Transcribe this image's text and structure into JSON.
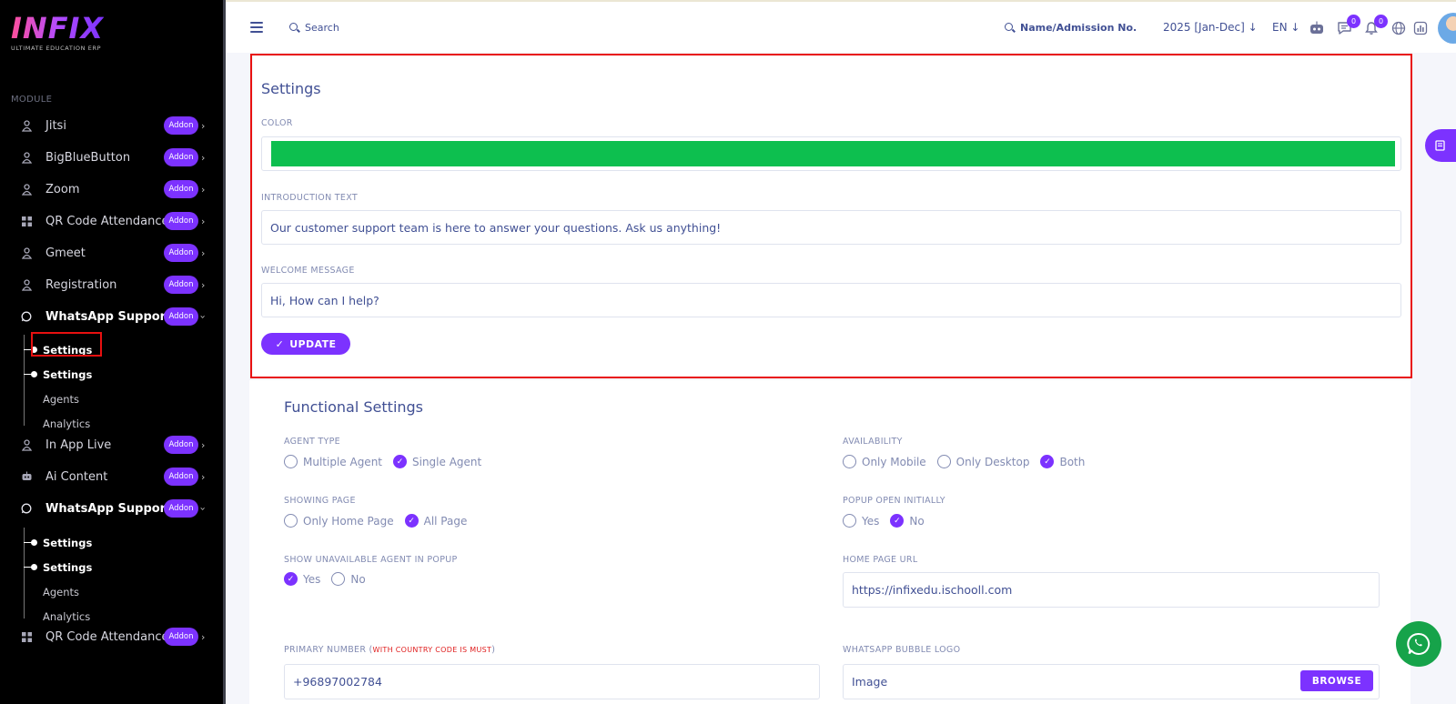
{
  "brand": {
    "name": "INFIX",
    "tagline": "ULTIMATE EDUCATION ERP"
  },
  "sidebar": {
    "section_label": "MODULE",
    "badge_label": "Addon",
    "items": [
      {
        "label": "Jitsi",
        "icon": "user-icon"
      },
      {
        "label": "BigBlueButton",
        "icon": "user-icon"
      },
      {
        "label": "Zoom",
        "icon": "user-icon"
      },
      {
        "label": "QR Code Attendance",
        "icon": "grid-icon"
      },
      {
        "label": "Gmeet",
        "icon": "user-icon"
      },
      {
        "label": "Registration",
        "icon": "user-icon"
      },
      {
        "label": "WhatsApp Support",
        "icon": "whatsapp-icon"
      },
      {
        "label": "In App Live",
        "icon": "user-icon"
      },
      {
        "label": "Ai Content",
        "icon": "robot-icon"
      },
      {
        "label": "WhatsApp Support",
        "icon": "whatsapp-icon"
      },
      {
        "label": "QR Code Attendance",
        "icon": "grid-icon"
      }
    ],
    "sub_group_1": [
      "Settings",
      "Settings",
      "Agents",
      "Analytics"
    ],
    "sub_group_2": [
      "Settings",
      "Settings",
      "Agents",
      "Analytics"
    ]
  },
  "topbar": {
    "search_label": "Search",
    "student_search_label": "Name/Admission No.",
    "session": "2025 [Jan-Dec]",
    "language": "EN",
    "message_count": "0",
    "notification_count": "0"
  },
  "settings_panel": {
    "title": "Settings",
    "color_label": "COLOR",
    "color_value": "#0dbf4f",
    "intro_label": "INTRODUCTION TEXT",
    "intro_value": "Our customer support team is here to answer your questions. Ask us anything!",
    "welcome_label": "WELCOME MESSAGE",
    "welcome_value": "Hi, How can I help?",
    "update_label": "UPDATE"
  },
  "functional": {
    "title": "Functional Settings",
    "agent_type": {
      "label": "AGENT TYPE",
      "options": [
        "Multiple Agent",
        "Single Agent"
      ],
      "selected": "Single Agent"
    },
    "availability": {
      "label": "AVAILABILITY",
      "options": [
        "Only Mobile",
        "Only Desktop",
        "Both"
      ],
      "selected": "Both"
    },
    "showing_page": {
      "label": "SHOWING PAGE",
      "options": [
        "Only Home Page",
        "All Page"
      ],
      "selected": "All Page"
    },
    "popup_open": {
      "label": "POPUP OPEN INITIALLY",
      "options": [
        "Yes",
        "No"
      ],
      "selected": "No"
    },
    "show_unavailable": {
      "label": "SHOW UNAVAILABLE AGENT IN POPUP",
      "options": [
        "Yes",
        "No"
      ],
      "selected": "Yes"
    },
    "home_url": {
      "label": "HOME PAGE URL",
      "value": "https://infixedu.ischooll.com"
    },
    "primary_number": {
      "label": "PRIMARY NUMBER (",
      "note": "WITH COUNTRY CODE IS MUST",
      "label_end": ")",
      "value": "+96897002784"
    },
    "bubble_logo": {
      "label": "WHATSAPP BUBBLE LOGO",
      "placeholder": "Image",
      "browse_label": "BROWSE"
    }
  },
  "colors": {
    "accent": "#7c32ff",
    "text": "#415094",
    "highlight": "#e81010",
    "whatsapp": "#16a34a"
  }
}
